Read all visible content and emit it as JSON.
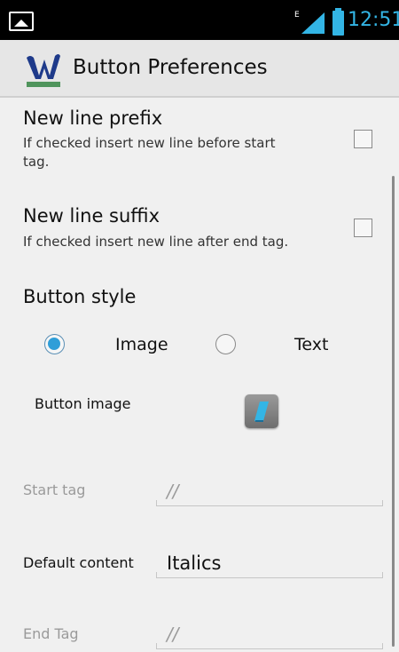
{
  "status_bar": {
    "time": "12:51",
    "network_type": "E",
    "notification_icon": "image-icon",
    "signal_icon": "signal-icon",
    "battery_icon": "battery-icon",
    "accent_color": "#33b5e5"
  },
  "action_bar": {
    "app_icon": "wordedit-logo-icon",
    "title": "Button Preferences"
  },
  "preferences": {
    "new_line_prefix": {
      "title": "New line prefix",
      "summary_line1": "If checked insert new line before start",
      "summary_line2": "tag.",
      "checked": false
    },
    "new_line_suffix": {
      "title": "New line suffix",
      "summary": "If checked insert new line after end tag.",
      "checked": false
    },
    "button_style": {
      "category": "Button style",
      "options": [
        {
          "label": "Image",
          "selected": true
        },
        {
          "label": "Text",
          "selected": false
        }
      ]
    },
    "button_image": {
      "label": "Button image",
      "icon": "italic-icon"
    },
    "start_tag": {
      "label": "Start tag",
      "placeholder": "//"
    },
    "default_content": {
      "label": "Default content",
      "value": "Italics"
    },
    "end_tag": {
      "label": "End Tag",
      "placeholder": "//"
    }
  }
}
